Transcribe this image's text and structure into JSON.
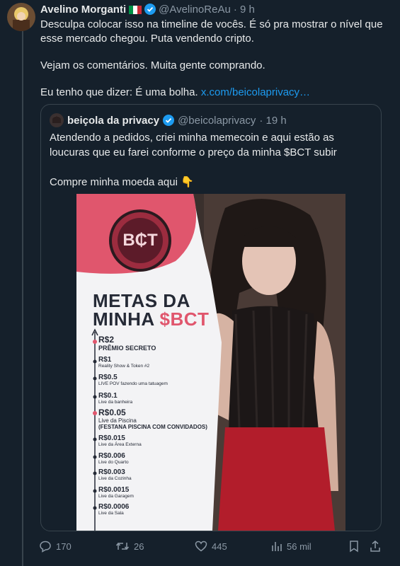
{
  "tweet": {
    "author_name": "Avelino Morganti",
    "author_handle": "@AvelinoReAu",
    "time": "· 9 h",
    "paragraphs": [
      "Desculpa colocar isso na timeline de vocês. É só pra mostrar o nível que esse mercado chegou. Puta vendendo cripto.",
      "Vejam os comentários. Muita gente comprando."
    ],
    "last_line_text": "Eu tenho que dizer: É uma bolha.",
    "link_text": "x.com/beicolaprivacy…"
  },
  "quote": {
    "author_name": "beiçola da privacy",
    "author_handle": "@beicolaprivacy",
    "time": "· 19 h",
    "paragraphs": [
      "Atendendo a pedidos, criei minha memecoin e aqui estão as loucuras que eu farei conforme o preço da minha $BCT subir",
      "Compre minha moeda aqui 👇"
    ],
    "image": {
      "logo": "B₵T",
      "title_line1": "METAS DA",
      "title_line2_prefix": "MINHA ",
      "title_line2_highlight": "$BCT",
      "goals": [
        {
          "price": "R$2",
          "desc": "PRÊMIO SECRETO"
        },
        {
          "price": "R$1",
          "desc": "Reality Show & Token #2"
        },
        {
          "price": "R$0.5",
          "desc": "LIVE POV fazendo uma tatuagem"
        },
        {
          "price": "R$0.1",
          "desc": "Live da banheira"
        },
        {
          "price": "R$0.05",
          "desc": "Live da Piscina",
          "desc2": "(FESTANA PISCINA COM CONVIDADOS)"
        },
        {
          "price": "R$0.015",
          "desc": "Live da Área Externa"
        },
        {
          "price": "R$0.006",
          "desc": "Live do Quarto"
        },
        {
          "price": "R$0.003",
          "desc": "Live da Cozinha"
        },
        {
          "price": "R$0.0015",
          "desc": "Live da Garagem"
        },
        {
          "price": "R$0.0006",
          "desc": "Live da Sala"
        }
      ]
    }
  },
  "actions": {
    "replies": "170",
    "retweets": "26",
    "likes": "445",
    "views": "56 mil"
  },
  "colors": {
    "background": "#15202b",
    "text": "#e7e9ea",
    "muted": "#8b98a5",
    "link": "#1d9bf0",
    "border": "#38444d",
    "accent_pink": "#e0566d"
  },
  "icons": {
    "verified": "verified-badge-icon",
    "flag": "italy-flag-icon",
    "reply": "reply-icon",
    "retweet": "retweet-icon",
    "like": "heart-icon",
    "views": "views-chart-icon",
    "bookmark": "bookmark-icon",
    "share": "share-icon"
  }
}
